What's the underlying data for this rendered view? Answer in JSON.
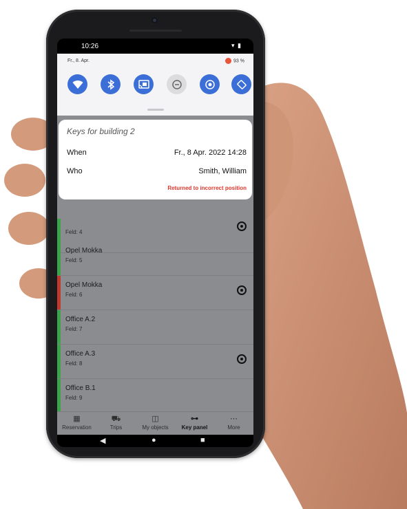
{
  "status_bar": {
    "time": "10:26",
    "icons": "▾ ▮"
  },
  "quick_settings": {
    "date": "Fr., 8. Apr.",
    "battery": "93 %",
    "tiles": [
      "wifi-icon",
      "bluetooth-icon",
      "cast-icon",
      "do-not-disturb-icon",
      "location-icon",
      "auto-rotate-icon"
    ]
  },
  "notification": {
    "title": "Keys for building 2",
    "when_label": "When",
    "when_value": "Fr., 8 Apr. 2022 14:28",
    "who_label": "Who",
    "who_value": "Smith, William",
    "status": "Returned  to incorrect position"
  },
  "list": {
    "items": [
      {
        "name": "",
        "field": "Feld: 4",
        "bar": "#3aa54a",
        "radio": true
      },
      {
        "name": "Opel Mokka",
        "field": "Feld: 5",
        "bar": "#3aa54a",
        "radio": false
      },
      {
        "name": "Opel Mokka",
        "field": "Feld: 6",
        "bar": "#c0392b",
        "radio": true
      },
      {
        "name": "Office A.2",
        "field": "Feld: 7",
        "bar": "#3aa54a",
        "radio": false
      },
      {
        "name": "Office A.3",
        "field": "Feld: 8",
        "bar": "#3aa54a",
        "radio": true
      },
      {
        "name": "Office B.1",
        "field": "Feld: 9",
        "bar": "#3aa54a",
        "radio": false
      }
    ]
  },
  "bottom_nav": {
    "items": [
      {
        "label": "Reservation",
        "icon": "reservation-icon",
        "glyph": "▦"
      },
      {
        "label": "Trips",
        "icon": "trips-icon",
        "glyph": "⛟"
      },
      {
        "label": "My objects",
        "icon": "objects-icon",
        "glyph": "◫"
      },
      {
        "label": "Key panel",
        "icon": "key-icon",
        "glyph": "⊶"
      },
      {
        "label": "More",
        "icon": "more-icon",
        "glyph": "⋯"
      }
    ],
    "active": "Key panel"
  },
  "system_nav": {
    "back": "◀",
    "home": "●",
    "recents": "■"
  },
  "colors": {
    "accent": "#3b6ed6",
    "alert": "#e2362b",
    "ok": "#3aa54a",
    "error": "#c0392b"
  }
}
